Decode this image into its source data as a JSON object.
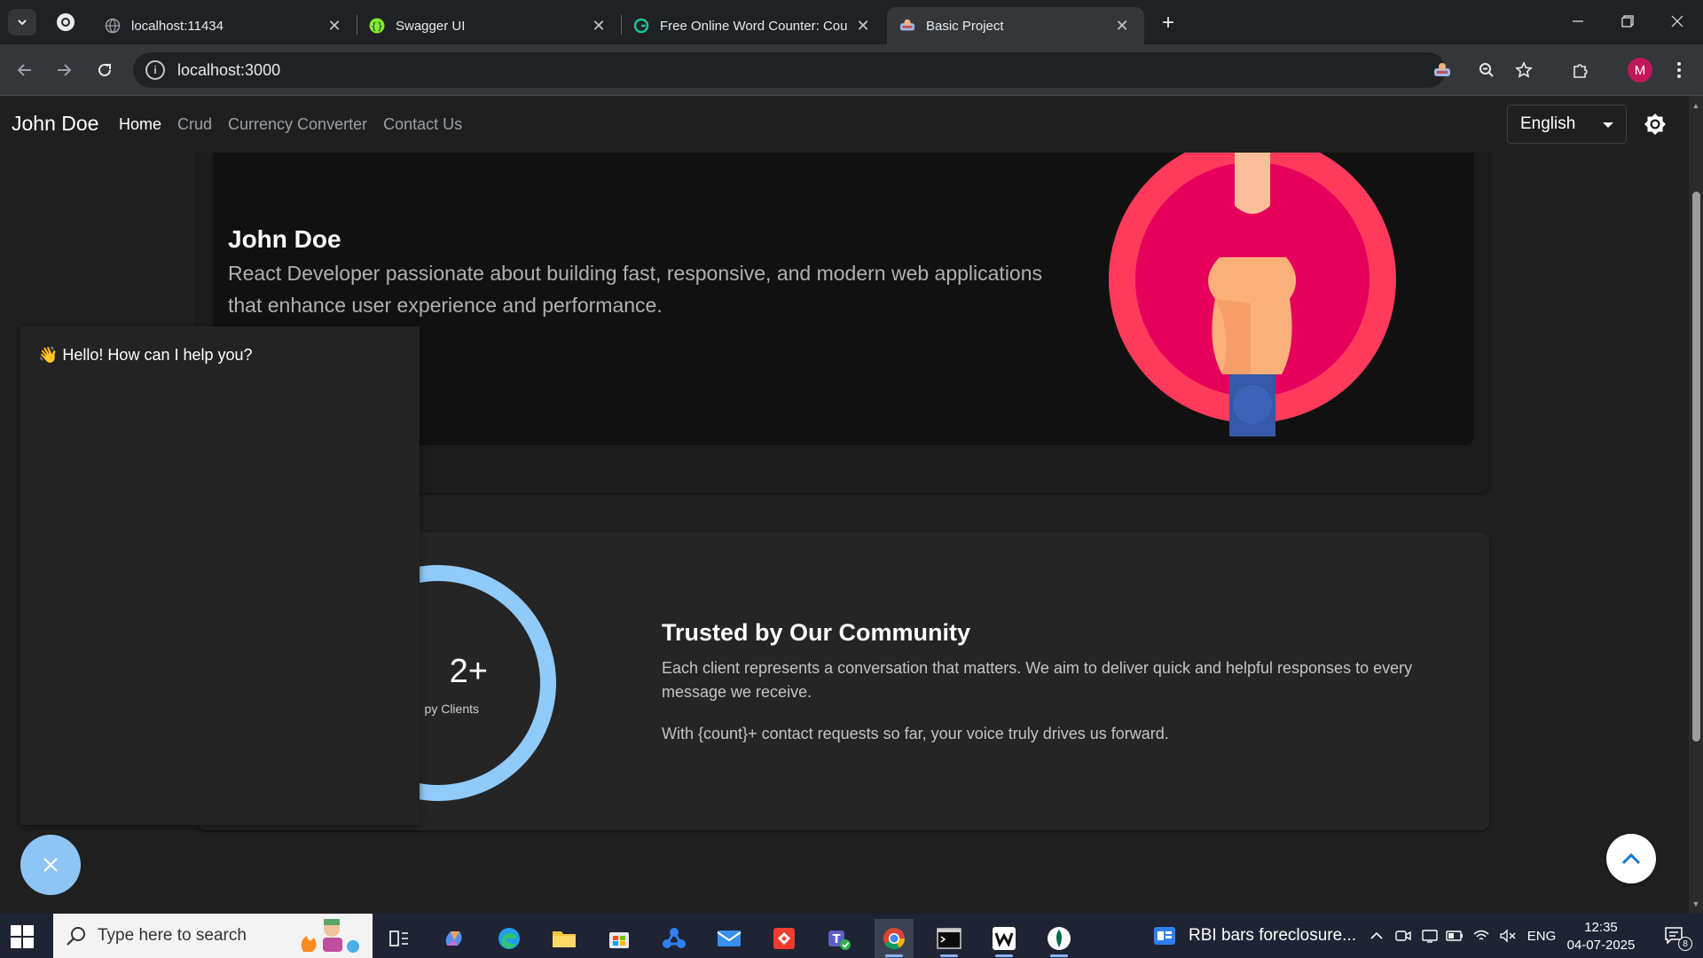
{
  "browser": {
    "tabs": [
      {
        "title": "localhost:11434"
      },
      {
        "title": "Swagger UI"
      },
      {
        "title": "Free Online Word Counter: Cou"
      },
      {
        "title": "Basic Project"
      }
    ],
    "address": "localhost:3000"
  },
  "navbar": {
    "brand": "John Doe",
    "links": [
      "Home",
      "Crud",
      "Currency Converter",
      "Contact Us"
    ],
    "active_link": "Home",
    "language": "English"
  },
  "hero": {
    "name": "John Doe",
    "description": "React Developer passionate about building fast, responsive, and modern web applications that enhance user experience and performance."
  },
  "trust": {
    "count_text": "2+",
    "count_label": "py Clients",
    "title": "Trusted by Our Community",
    "paragraph1": "Each client represents a conversation that matters. We aim to deliver quick and helpful responses to every message we receive.",
    "paragraph2": "With {count}+ contact requests so far, your voice truly drives us forward."
  },
  "chat": {
    "greeting": "👋 Hello! How can I help you?"
  },
  "taskbar": {
    "search_placeholder": "Type here to search",
    "news": "RBI bars foreclosure...",
    "language": "ENG",
    "time": "12:35",
    "date": "04-07-2025",
    "notification_count": "8"
  },
  "colors": {
    "accent_ring": "#90caf9",
    "avatar_outer": "#ff3b5c",
    "avatar_inner": "#e8005a",
    "chat_button": "#8ec5f5"
  }
}
